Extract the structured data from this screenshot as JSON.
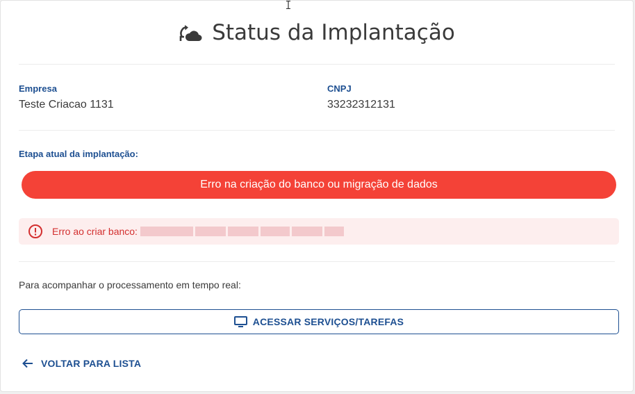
{
  "header": {
    "title": "Status da Implantação",
    "icon": "cloud-sync-icon"
  },
  "company": {
    "label": "Empresa",
    "value": "Teste Criacao 1131"
  },
  "cnpj": {
    "label": "CNPJ",
    "value": "33232312131"
  },
  "step": {
    "label": "Etapa atual da implantação:",
    "status": "Erro na criação do banco ou migração de dados",
    "status_color": "#f44237"
  },
  "error_alert": {
    "icon": "error-outline-icon",
    "message": "Erro ao criar banco:",
    "color": "#d32f2f",
    "background": "#fdeeee"
  },
  "realtime": {
    "instructions": "Para acompanhar o processamento em tempo real:",
    "button_label": "ACESSAR SERVIÇOS/TAREFAS",
    "button_icon": "monitor-icon"
  },
  "back": {
    "label": "VOLTAR PARA LISTA",
    "icon": "arrow-left-icon"
  },
  "colors": {
    "accent": "#1d4f91",
    "text": "#3a3a3a"
  }
}
